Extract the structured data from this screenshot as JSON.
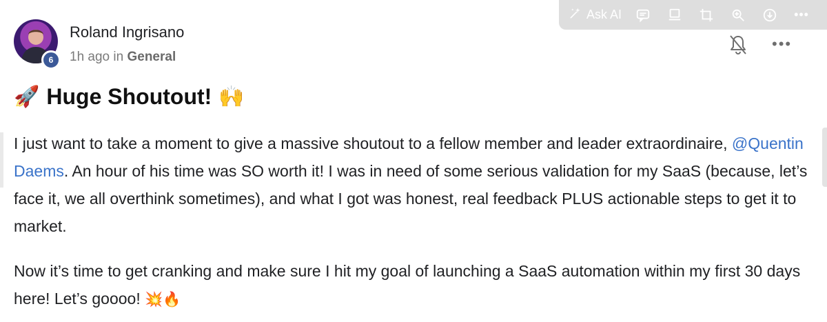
{
  "toolbar": {
    "ask_ai_label": "Ask AI",
    "icons": [
      "ask-ai-icon",
      "comment-icon",
      "board-icon",
      "crop-icon",
      "zoom-icon",
      "download-icon",
      "more-icon"
    ],
    "more_glyph": "•••"
  },
  "post": {
    "author": {
      "name": "Roland Ingrisano",
      "level": "6"
    },
    "time": "1h ago",
    "in_text": "in",
    "category": "General",
    "title_emoji_left": "🚀",
    "title": "Huge Shoutout!",
    "title_emoji_right": "🙌",
    "paragraph1": {
      "before": "I just want to take a moment to give a massive shoutout to a fellow member and leader extraordinaire, ",
      "mention": "@Quentin Daems",
      "after": ". An hour of his time was SO worth it! I was in need of some serious validation for my SaaS (because, let’s face it, we all overthink sometimes), and what I got was honest, real feedback PLUS actionable steps to get it to market."
    },
    "paragraph2": {
      "text": "Now it’s time to get cranking and make sure I hit my goal of launching a SaaS automation within my first 30 days here! Let’s goooo! ",
      "emojis": "💥🔥"
    },
    "more_glyph": "•••"
  }
}
